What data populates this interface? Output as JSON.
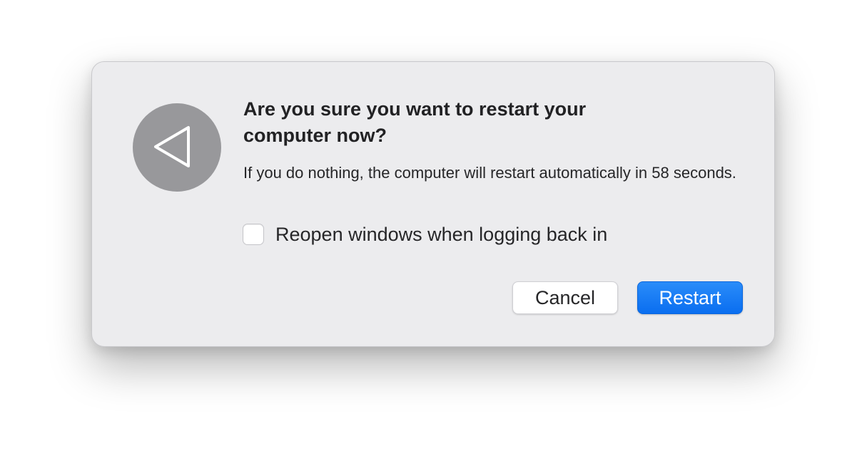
{
  "dialog": {
    "icon": "restart-triangle-icon",
    "title": "Are you sure you want to restart your computer now?",
    "message": "If you do nothing, the computer will restart automatically in 58 seconds.",
    "reopen_checkbox": {
      "label": "Reopen windows when logging back in",
      "checked": false
    },
    "buttons": {
      "cancel_label": "Cancel",
      "restart_label": "Restart"
    }
  },
  "colors": {
    "dialog_background": "#ececee",
    "icon_background": "#98989b",
    "accent": "#0a6ef0"
  }
}
